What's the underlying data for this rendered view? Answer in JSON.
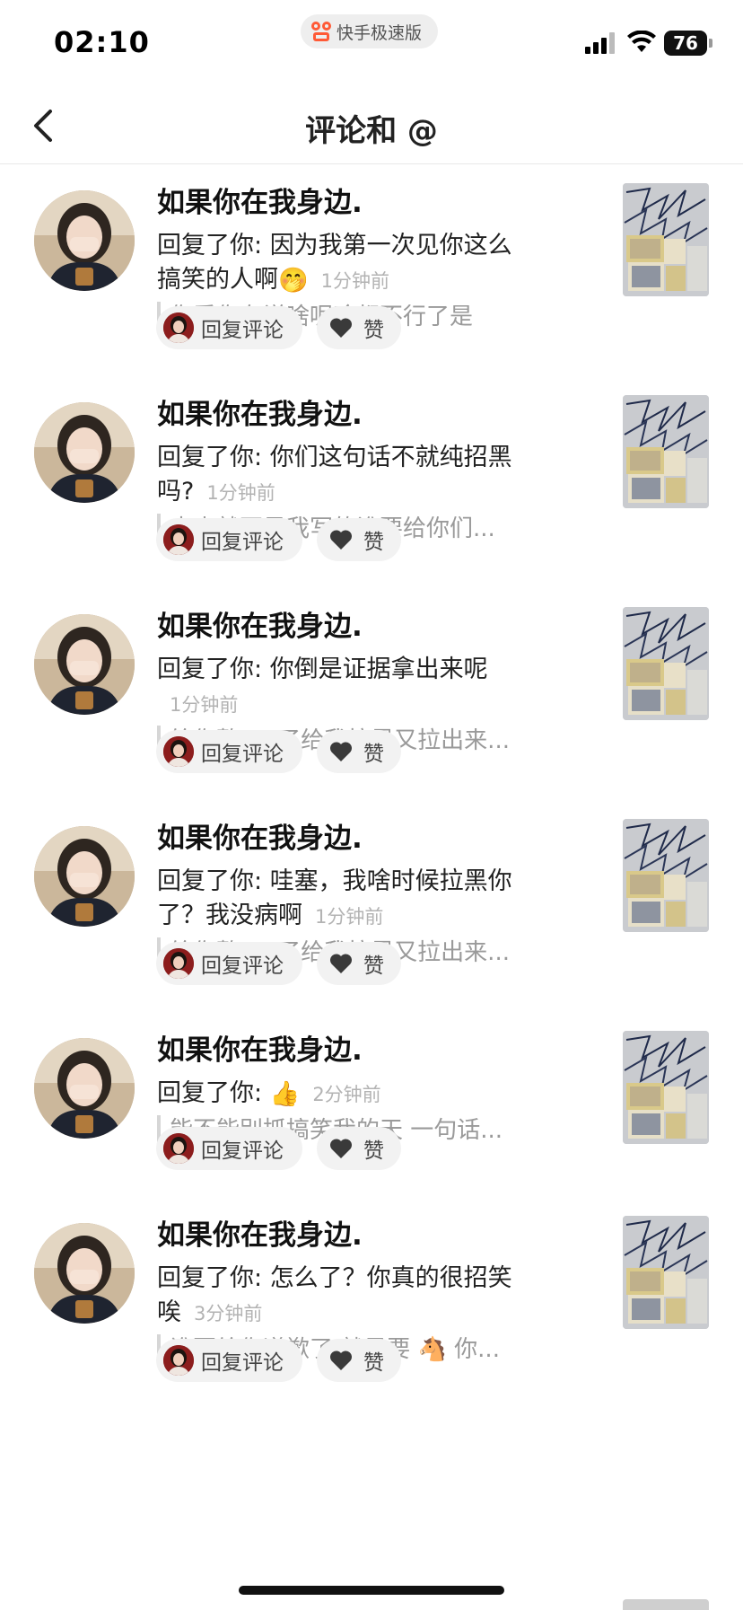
{
  "status_bar": {
    "time": "02:10",
    "app_name": "快手极速版",
    "battery": "76"
  },
  "nav": {
    "title": "评论和 @",
    "back_icon": "chevron-left-icon"
  },
  "actions": {
    "reply_label": "回复评论",
    "like_label": "赞"
  },
  "items": [
    {
      "name": "如果你在我身边.",
      "reply_prefix": "回复了你: ",
      "reply_text": "因为我第一次见你这么搞笑的人啊",
      "reply_emoji": "🤭",
      "time": "1分钟前",
      "quote": "你看你在说啥呢啥都不行了是"
    },
    {
      "name": "如果你在我身边.",
      "reply_prefix": "回复了你: ",
      "reply_text": "你们这句话不就纯招黑吗?",
      "reply_emoji": "",
      "time": "1分钟前",
      "quote": "本来就不是我写的谁要给你们..."
    },
    {
      "name": "如果你在我身边.",
      "reply_prefix": "回复了你: ",
      "reply_text": "你倒是证据拿出来呢",
      "reply_emoji": "",
      "time": "1分钟前",
      "quote": "给你整 pf 了给我拉黑又拉出来..."
    },
    {
      "name": "如果你在我身边.",
      "reply_prefix": "回复了你: ",
      "reply_text": "哇塞，我啥时候拉黑你了？我没病啊",
      "reply_emoji": "",
      "time": "1分钟前",
      "quote": "给你整 pf 了给我拉黑又拉出来..."
    },
    {
      "name": "如果你在我身边.",
      "reply_prefix": "回复了你: ",
      "reply_text": "",
      "reply_emoji": "👍",
      "time": "2分钟前",
      "quote": "能不能别抓搞笑我的天 一句话..."
    },
    {
      "name": "如果你在我身边.",
      "reply_prefix": "回复了你: ",
      "reply_text": "怎么了？你真的很招笑唉",
      "reply_emoji": "",
      "time": "3分钟前",
      "quote": "谁要给你道歉了 就是要 🐴 你..."
    }
  ]
}
